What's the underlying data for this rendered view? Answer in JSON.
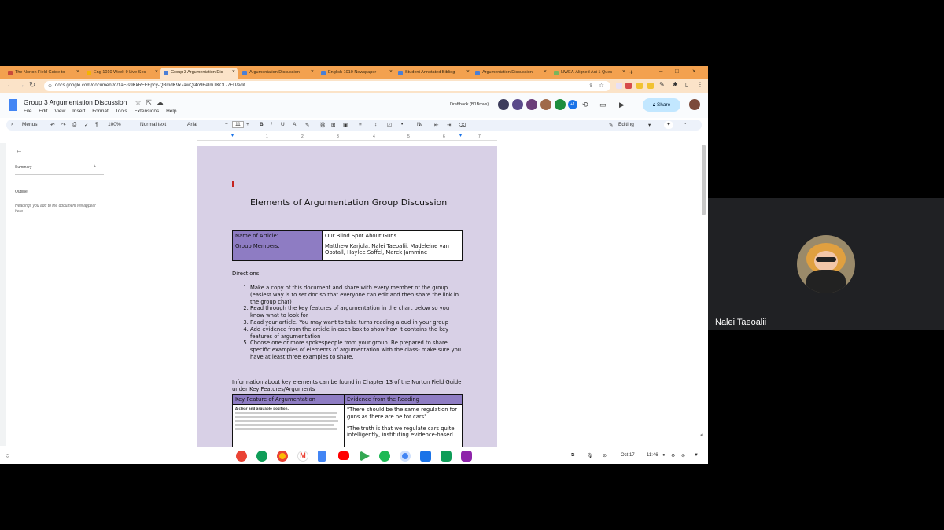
{
  "tabs": [
    {
      "label": "The Norton Field Guide to",
      "icon": "book-icon",
      "active": false
    },
    {
      "label": "Eng 1010 Week 9 Live Ses",
      "icon": "slides-icon",
      "active": false
    },
    {
      "label": "Group 3 Argumentation Dis",
      "icon": "docs-icon",
      "active": true
    },
    {
      "label": "Argumentation Discussion",
      "icon": "docs-icon",
      "active": false
    },
    {
      "label": "English 1010 Newspaper",
      "icon": "docs-icon",
      "active": false
    },
    {
      "label": "Student Annotated Bibliog",
      "icon": "docs-icon",
      "active": false
    },
    {
      "label": "Argumentation Discussion",
      "icon": "docs-icon",
      "active": false
    },
    {
      "label": "NWEA-Aligned Act 1 Ques",
      "icon": "globe-icon",
      "active": false
    }
  ],
  "url": "docs.google.com/document/d/1aF-s9KkRFFEpcy-QBmdK9x7awQt4o9BeImTKOL-7FU/edit",
  "doc": {
    "title": "Group 3 Argumentation Discussion",
    "menu": [
      "File",
      "Edit",
      "View",
      "Insert",
      "Format",
      "Tools",
      "Extensions",
      "Help"
    ],
    "draftback": "Draftback (B1Bmvs)",
    "extra_avatars": "+1",
    "share_label": "Share"
  },
  "toolbar": {
    "menus": "Menus",
    "zoom": "100%",
    "style": "Normal text",
    "font": "Arial",
    "font_size": "11",
    "mode": "Editing"
  },
  "ruler_ticks": [
    "1",
    "2",
    "3",
    "4",
    "5",
    "6",
    "7"
  ],
  "left_panel": {
    "summary": "Summary",
    "outline": "Outline",
    "outline_hint": "Headings you add to the document will appear here."
  },
  "page": {
    "heading": "Elements of Argumentation Group Discussion",
    "info_rows": [
      {
        "label": "Name of Article:",
        "value": "Our Blind Spot About Guns"
      },
      {
        "label": "Group Members:",
        "value": "Matthew Karjola, Nalei Taeoalii, Madeleine van Opstall, Haylee Soffel, Marek Jammine"
      }
    ],
    "directions_label": "Directions:",
    "directions": [
      "Make a copy of this document and share with every member of the group (easiest way is to set doc so that everyone can edit and then share the link in the group chat)",
      "Read through the key features of argumentation in the chart below so you know what to look for",
      "Read your article. You may want to take turns reading aloud in your group",
      "Add evidence from the article in each box to show how it contains the key features of argumentation",
      "Choose one or more spokespeople from your group. Be prepared to share specific examples of elements of argumentation with the class- make sure you have at least three examples to share."
    ],
    "info_note": "Information about key elements can be found in Chapter 13 of the Norton Field Guide under Key Features/Arguments",
    "table_headers": [
      "Key Feature of Argumentation",
      "Evidence from the Reading"
    ],
    "feature_snippet": "A clear and arguable position.",
    "evidence": [
      "\"There should be the same regulation for guns as there are be for cars\"",
      "\"The truth is that we regulate cars quite intelligently, instituting evidence-based"
    ]
  },
  "shelf": {
    "date": "Oct 17",
    "time": "11:46"
  },
  "participant": {
    "name": "Nalei Taeoalii"
  }
}
